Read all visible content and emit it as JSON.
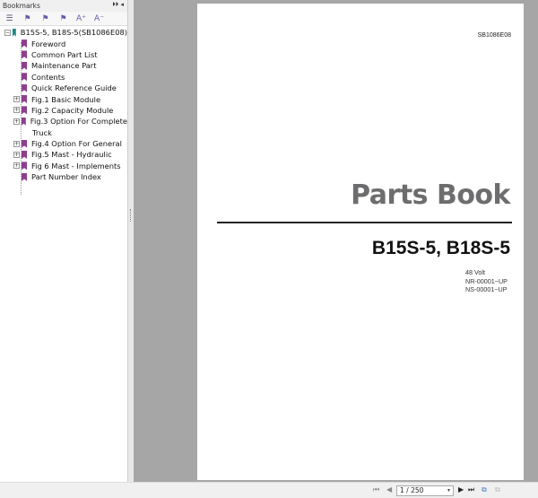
{
  "sidebar": {
    "title": "Bookmarks",
    "header_controls": "⏵⏵ ◂",
    "tools": [
      {
        "icon": "options-icon",
        "glyph": "☰"
      },
      {
        "icon": "expand-bookmark-icon",
        "glyph": "⚑"
      },
      {
        "icon": "collapse-bookmark-icon",
        "glyph": "⚑"
      },
      {
        "icon": "go-bookmark-icon",
        "glyph": "⚑"
      },
      {
        "icon": "font-increase-icon",
        "glyph": "A⁺"
      },
      {
        "icon": "font-decrease-icon",
        "glyph": "A⁻"
      }
    ],
    "root": "B15S-5, B18S-5(SB1086E08)",
    "items": [
      {
        "label": "Foreword",
        "expandable": false
      },
      {
        "label": "Common Part List",
        "expandable": false
      },
      {
        "label": "Maintenance Part",
        "expandable": false
      },
      {
        "label": "Contents",
        "expandable": false
      },
      {
        "label": "Quick Reference Guide",
        "expandable": false
      },
      {
        "label": "Fig.1 Basic Module",
        "expandable": true
      },
      {
        "label": "Fig.2 Capacity Module",
        "expandable": true
      },
      {
        "label": "Fig.3 Option For Complete",
        "label2": "Truck",
        "expandable": true
      },
      {
        "label": "Fig.4 Option For General",
        "expandable": true
      },
      {
        "label": "Fig.5 Mast - Hydraulic",
        "expandable": true
      },
      {
        "label": "Fig 6 Mast - Implements",
        "expandable": true
      },
      {
        "label": "Part Number Index",
        "expandable": false
      }
    ]
  },
  "page": {
    "doc_code": "SB1086E08",
    "title": "Parts Book",
    "model": "B15S-5, B18S-5",
    "specs": [
      "48 Volt",
      "NR-00001~UP",
      "NS-00001~UP"
    ]
  },
  "navigation": {
    "first": "⏮",
    "prev": "◀",
    "page_value": "1 / 250",
    "dropdown": "▾",
    "next": "▶",
    "last": "⏭",
    "fit1": "⧉",
    "fit2": "⧉"
  }
}
